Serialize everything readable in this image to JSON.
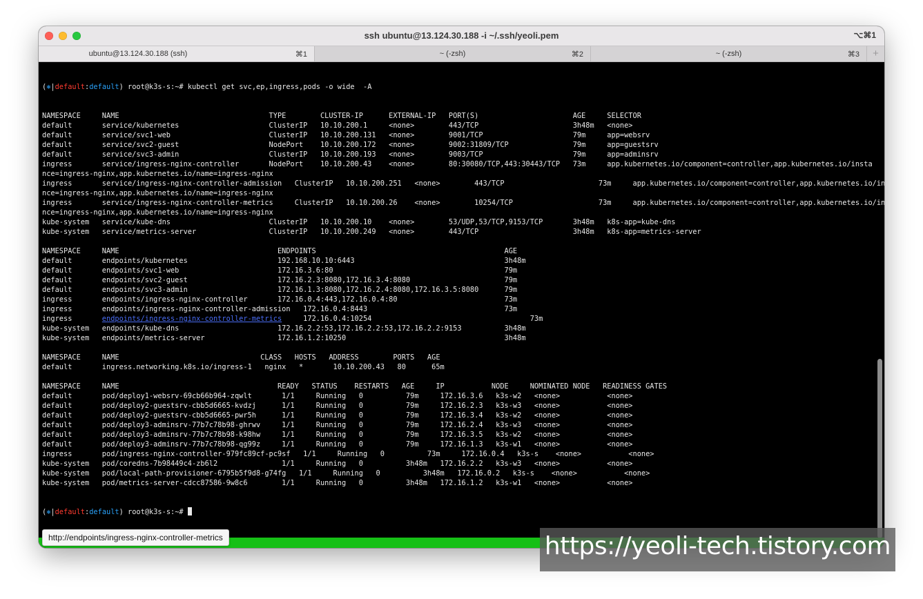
{
  "window": {
    "title": "ssh ubuntu@13.124.30.188 -i ~/.ssh/yeoli.pem",
    "shortcut": "⌥⌘1"
  },
  "tabs": [
    {
      "label": "ubuntu@13.124.30.188 (ssh)",
      "key": "⌘1"
    },
    {
      "label": "~ (-zsh)",
      "key": "⌘2"
    },
    {
      "label": "~ (-zsh)",
      "key": "⌘3"
    }
  ],
  "tab_add": "+",
  "prompt": {
    "open": "(",
    "star": "⎈",
    "pipe": "|",
    "context": "default",
    "colon": ":",
    "namespace": "default",
    "close_user": ") root@k3s-s:~# "
  },
  "command": "kubectl get svc,ep,ingress,pods -o wide  -A",
  "output_lines": [
    "NAMESPACE     NAME                                   TYPE        CLUSTER-IP      EXTERNAL-IP   PORT(S)                      AGE     SELECTOR",
    "default       service/kubernetes                     ClusterIP   10.10.200.1     <none>        443/TCP                      3h48m   <none>",
    "default       service/svc1-web                       ClusterIP   10.10.200.131   <none>        9001/TCP                     79m     app=websrv",
    "default       service/svc2-guest                     NodePort    10.10.200.172   <none>        9002:31809/TCP               79m     app=guestsrv",
    "default       service/svc3-admin                     ClusterIP   10.10.200.193   <none>        9003/TCP                     79m     app=adminsrv",
    "ingress       service/ingress-nginx-controller       NodePort    10.10.200.43    <none>        80:30080/TCP,443:30443/TCP   73m     app.kubernetes.io/component=controller,app.kubernetes.io/insta",
    "nce=ingress-nginx,app.kubernetes.io/name=ingress-nginx",
    "ingress       service/ingress-nginx-controller-admission   ClusterIP   10.10.200.251   <none>        443/TCP                      73m     app.kubernetes.io/component=controller,app.kubernetes.io/insta",
    "nce=ingress-nginx,app.kubernetes.io/name=ingress-nginx",
    "ingress       service/ingress-nginx-controller-metrics     ClusterIP   10.10.200.26    <none>        10254/TCP                    73m     app.kubernetes.io/component=controller,app.kubernetes.io/insta",
    "nce=ingress-nginx,app.kubernetes.io/name=ingress-nginx",
    "kube-system   service/kube-dns                       ClusterIP   10.10.200.10    <none>        53/UDP,53/TCP,9153/TCP       3h48m   k8s-app=kube-dns",
    "kube-system   service/metrics-server                 ClusterIP   10.10.200.249   <none>        443/TCP                      3h48m   k8s-app=metrics-server",
    "",
    "NAMESPACE     NAME                                     ENDPOINTS                                            AGE",
    "default       endpoints/kubernetes                     192.168.10.10:6443                                   3h48m",
    "default       endpoints/svc1-web                       172.16.3.6:80                                        79m",
    "default       endpoints/svc2-guest                     172.16.2.3:8080,172.16.3.4:8080                      79m",
    "default       endpoints/svc3-admin                     172.16.1.3:8080,172.16.2.4:8080,172.16.3.5:8080      79m",
    "ingress       endpoints/ingress-nginx-controller       172.16.0.4:443,172.16.0.4:80                         73m",
    "ingress       endpoints/ingress-nginx-controller-admission   172.16.0.4:8443                                73m",
    "__LINK__",
    "kube-system   endpoints/kube-dns                       172.16.2.2:53,172.16.2.2:53,172.16.2.2:9153          3h48m",
    "kube-system   endpoints/metrics-server                 172.16.1.2:10250                                     3h48m",
    "",
    "NAMESPACE     NAME                                 CLASS   HOSTS   ADDRESS        PORTS   AGE",
    "default       ingress.networking.k8s.io/ingress-1   nginx   *       10.10.200.43   80      65m",
    "",
    "NAMESPACE     NAME                                     READY   STATUS    RESTARTS   AGE     IP           NODE     NOMINATED NODE   READINESS GATES",
    "default       pod/deploy1-websrv-69cb66b964-zqwlt       1/1     Running   0          79m     172.16.3.6   k3s-w2   <none>           <none>",
    "default       pod/deploy2-guestsrv-cbb5d6665-kvdzj      1/1     Running   0          79m     172.16.2.3   k3s-w3   <none>           <none>",
    "default       pod/deploy2-guestsrv-cbb5d6665-pwr5h      1/1     Running   0          79m     172.16.3.4   k3s-w2   <none>           <none>",
    "default       pod/deploy3-adminsrv-77b7c78b98-ghrwv     1/1     Running   0          79m     172.16.2.4   k3s-w3   <none>           <none>",
    "default       pod/deploy3-adminsrv-77b7c78b98-k98hw     1/1     Running   0          79m     172.16.3.5   k3s-w2   <none>           <none>",
    "default       pod/deploy3-adminsrv-77b7c78b98-qg99z     1/1     Running   0          79m     172.16.1.3   k3s-w1   <none>           <none>",
    "ingress       pod/ingress-nginx-controller-979fc89cf-pc9sf   1/1     Running   0          73m     172.16.0.4   k3s-s    <none>           <none>",
    "kube-system   pod/coredns-7b98449c4-zb6l2               1/1     Running   0          3h48m   172.16.2.2   k3s-w3   <none>           <none>",
    "kube-system   pod/local-path-provisioner-6795b5f9d8-g74fg   1/1     Running   0          3h48m   172.16.0.2   k3s-s    <none>           <none>",
    "kube-system   pod/metrics-server-cdcc87586-9w8c6        1/1     Running   0          3h48m   172.16.1.2   k3s-w1   <none>           <none>"
  ],
  "link_line": {
    "prefix": "ingress       ",
    "link_text": "endpoints/ingress-nginx-controller-metrics",
    "suffix": "     172.16.0.4:10254                                     73m"
  },
  "tooltip": "http://endpoints/ingress-nginx-controller-metrics",
  "watermark": "https://yeoli-tech.tistory.com"
}
